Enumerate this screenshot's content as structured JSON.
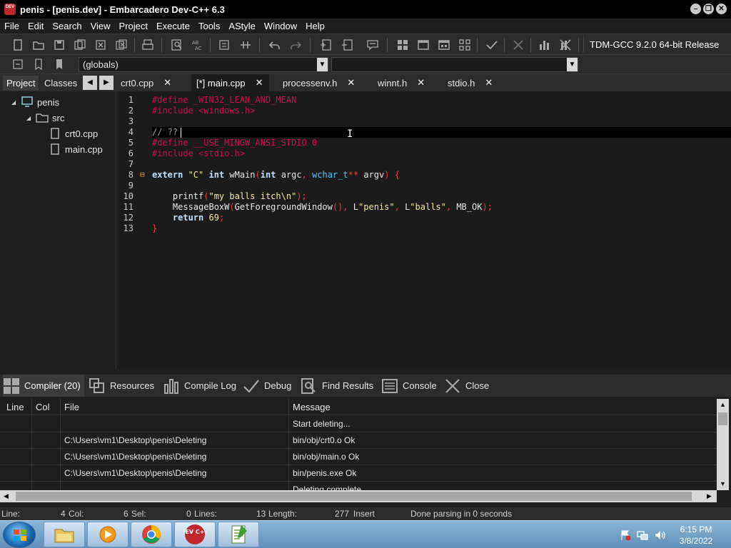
{
  "window": {
    "title": "penis - [penis.dev] - Embarcadero Dev-C++ 6.3",
    "app_icon_text": "DEV"
  },
  "menu": [
    "File",
    "Edit",
    "Search",
    "View",
    "Project",
    "Execute",
    "Tools",
    "AStyle",
    "Window",
    "Help"
  ],
  "toolbar": {
    "compiler": "TDM-GCC 9.2.0 64-bit Release",
    "scope_select": "(globals)",
    "function_select": ""
  },
  "left_panel": {
    "tabs": [
      "Project",
      "Classes"
    ],
    "tree": {
      "root": "penis",
      "folder": "src",
      "files": [
        "crt0.cpp",
        "main.cpp"
      ]
    }
  },
  "file_tabs": [
    {
      "label": "crt0.cpp"
    },
    {
      "label": "[*] main.cpp"
    },
    {
      "label": "processenv.h"
    },
    {
      "label": "winnt.h"
    },
    {
      "label": "stdio.h"
    }
  ],
  "editor": {
    "line_numbers": [
      "1",
      "2",
      "3",
      "4",
      "5",
      "6",
      "7",
      "8",
      "9",
      "10",
      "11",
      "12",
      "13"
    ],
    "lines": [
      [
        {
          "t": "pp",
          "s": "#define _WIN32_LEAN_AND_MEAN"
        }
      ],
      [
        {
          "t": "pp",
          "s": "#include <windows.h>"
        }
      ],
      [],
      [
        {
          "t": "cm",
          "s": "// ??"
        }
      ],
      [
        {
          "t": "pp",
          "s": "#define __USE_MINGW_ANSI_STDIO 0"
        }
      ],
      [
        {
          "t": "pp",
          "s": "#include <stdio.h>"
        }
      ],
      [],
      [
        {
          "t": "kw",
          "s": "extern "
        },
        {
          "t": "str",
          "s": "\"C\""
        },
        {
          "t": "id",
          "s": " "
        },
        {
          "t": "kw",
          "s": "int"
        },
        {
          "t": "id",
          "s": " wMain"
        },
        {
          "t": "sym",
          "s": "("
        },
        {
          "t": "kw",
          "s": "int"
        },
        {
          "t": "id",
          "s": " argc"
        },
        {
          "t": "sym",
          "s": ","
        },
        {
          "t": "id",
          "s": " "
        },
        {
          "t": "type",
          "s": "wchar_t"
        },
        {
          "t": "sym",
          "s": "**"
        },
        {
          "t": "id",
          "s": " argv"
        },
        {
          "t": "sym",
          "s": ")"
        },
        {
          "t": "id",
          "s": " "
        },
        {
          "t": "sym",
          "s": "{"
        }
      ],
      [],
      [
        {
          "t": "id",
          "s": "    printf"
        },
        {
          "t": "sym",
          "s": "("
        },
        {
          "t": "str",
          "s": "\"my balls itch\\n\""
        },
        {
          "t": "sym",
          "s": ");"
        }
      ],
      [
        {
          "t": "id",
          "s": "    MessageBoxW"
        },
        {
          "t": "sym",
          "s": "("
        },
        {
          "t": "id",
          "s": "GetForegroundWindow"
        },
        {
          "t": "sym",
          "s": "(),"
        },
        {
          "t": "id",
          "s": " L"
        },
        {
          "t": "str",
          "s": "\"penis\""
        },
        {
          "t": "sym",
          "s": ","
        },
        {
          "t": "id",
          "s": " L"
        },
        {
          "t": "str",
          "s": "\"balls\""
        },
        {
          "t": "sym",
          "s": ","
        },
        {
          "t": "id",
          "s": " MB_OK"
        },
        {
          "t": "sym",
          "s": ");"
        }
      ],
      [
        {
          "t": "kw",
          "s": "    return "
        },
        {
          "t": "num",
          "s": "69"
        },
        {
          "t": "sym",
          "s": ";"
        }
      ],
      [
        {
          "t": "sym",
          "s": "}"
        }
      ]
    ],
    "fold_marker": "⊟"
  },
  "bottom_tabs": [
    {
      "label": "Compiler (20)",
      "icon": "grid-icon"
    },
    {
      "label": "Resources",
      "icon": "resources-icon"
    },
    {
      "label": "Compile Log",
      "icon": "bar-chart-icon"
    },
    {
      "label": "Debug",
      "icon": "check-icon"
    },
    {
      "label": "Find Results",
      "icon": "search-doc-icon"
    },
    {
      "label": "Console",
      "icon": "console-icon"
    },
    {
      "label": "Close",
      "icon": "close-icon"
    }
  ],
  "messages": {
    "columns": [
      "Line",
      "Col",
      "File",
      "Message"
    ],
    "rows": [
      {
        "line": "",
        "col": "",
        "file": "",
        "message": "Start deleting..."
      },
      {
        "line": "",
        "col": "",
        "file": "C:\\Users\\vm1\\Desktop\\penis\\Deleting",
        "message": "bin/obj/crt0.o Ok"
      },
      {
        "line": "",
        "col": "",
        "file": "C:\\Users\\vm1\\Desktop\\penis\\Deleting",
        "message": "bin/obj/main.o Ok"
      },
      {
        "line": "",
        "col": "",
        "file": "C:\\Users\\vm1\\Desktop\\penis\\Deleting",
        "message": "bin/penis.exe Ok"
      },
      {
        "line": "",
        "col": "",
        "file": "",
        "message": "Deleting complete"
      }
    ]
  },
  "status": {
    "line_label": "Line:",
    "line_value": "4",
    "col_label": "Col:",
    "col_value": "6",
    "sel_label": "Sel:",
    "sel_value": "0",
    "lines_label": "Lines:",
    "lines_value": "13",
    "length_label": "Length:",
    "length_value": "277",
    "mode": "Insert",
    "message": "Done parsing in 0 seconds"
  },
  "taskbar": {
    "time": "6:15 PM",
    "date": "3/8/2022",
    "apps": [
      "explorer-icon",
      "media-player-icon",
      "chrome-icon",
      "devcpp-icon",
      "notepad-icon"
    ],
    "devcpp_icon_text": "DEV C++"
  }
}
